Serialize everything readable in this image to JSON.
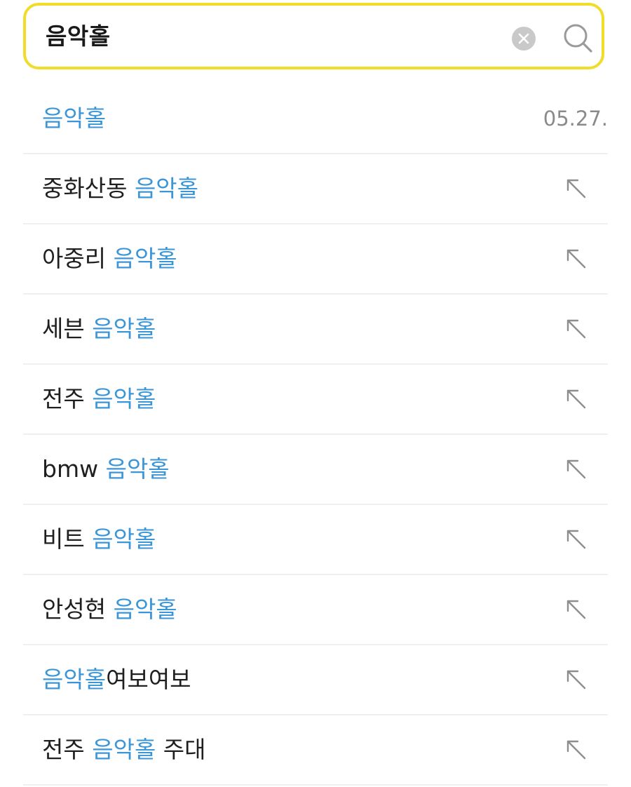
{
  "search": {
    "query": "음악홀",
    "clear_icon": "clear-circle-icon",
    "search_icon": "search-icon",
    "accent_border": "#f2dc2a"
  },
  "colors": {
    "highlight": "#3b96d8",
    "text": "#1f1f1f",
    "muted": "#8a8a8a",
    "divider": "#efefef"
  },
  "recent": {
    "text": "음악홀",
    "date": "05.27."
  },
  "suggestions": [
    {
      "prefix": "중화산동 ",
      "match": "음악홀",
      "suffix": ""
    },
    {
      "prefix": "아중리 ",
      "match": "음악홀",
      "suffix": ""
    },
    {
      "prefix": "세븐 ",
      "match": "음악홀",
      "suffix": ""
    },
    {
      "prefix": "전주 ",
      "match": "음악홀",
      "suffix": ""
    },
    {
      "prefix": "bmw ",
      "match": "음악홀",
      "suffix": ""
    },
    {
      "prefix": "비트 ",
      "match": "음악홀",
      "suffix": ""
    },
    {
      "prefix": "안성현 ",
      "match": "음악홀",
      "suffix": ""
    },
    {
      "prefix": "",
      "match": "음악홀",
      "suffix": "여보여보"
    },
    {
      "prefix": "전주 ",
      "match": "음악홀",
      "suffix": " 주대"
    }
  ]
}
